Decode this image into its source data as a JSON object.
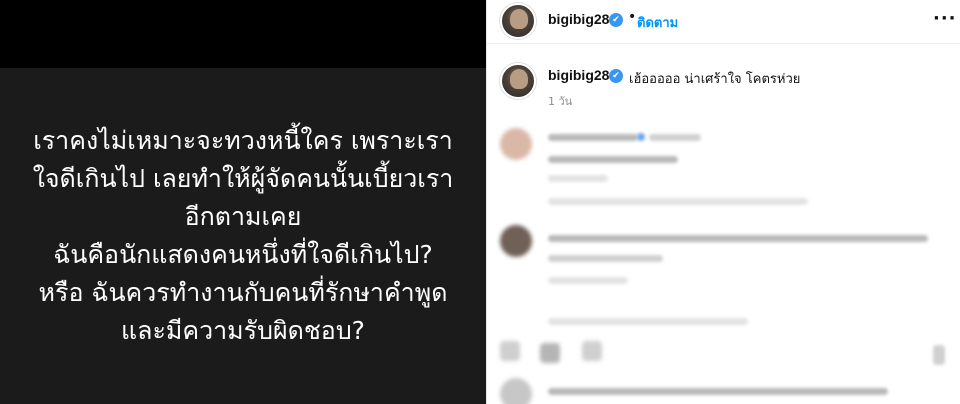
{
  "story": {
    "lines": [
      "เราคงไม่เหมาะจะทวงหนี้ใคร เพราะเรา",
      "ใจดีเกินไป เลยทำให้ผู้จัดคนนั้นเบี้ยวเรา",
      "อีกตามเคย",
      "ฉันคือนักแสดงคนหนึ่งที่ใจดีเกินไป?",
      "หรือ ฉันควรทำงานกับคนที่รักษาคำพูด",
      "และมีความรับผิดชอบ?"
    ]
  },
  "post": {
    "header": {
      "username": "bigibig28",
      "verified_icon": "✔",
      "separator": "•",
      "follow_label": "ติดตาม",
      "more_label": "···"
    },
    "caption": {
      "username": "bigibig28",
      "verified_icon": "✔",
      "text": "เฮ้อออออ น่าเศร้าใจ โคตรห่วย",
      "time": "1 วัน"
    }
  },
  "colors": {
    "story_bg": "#1b1b1b",
    "follow_blue": "#0095f6",
    "verified_blue": "#3897f0"
  }
}
